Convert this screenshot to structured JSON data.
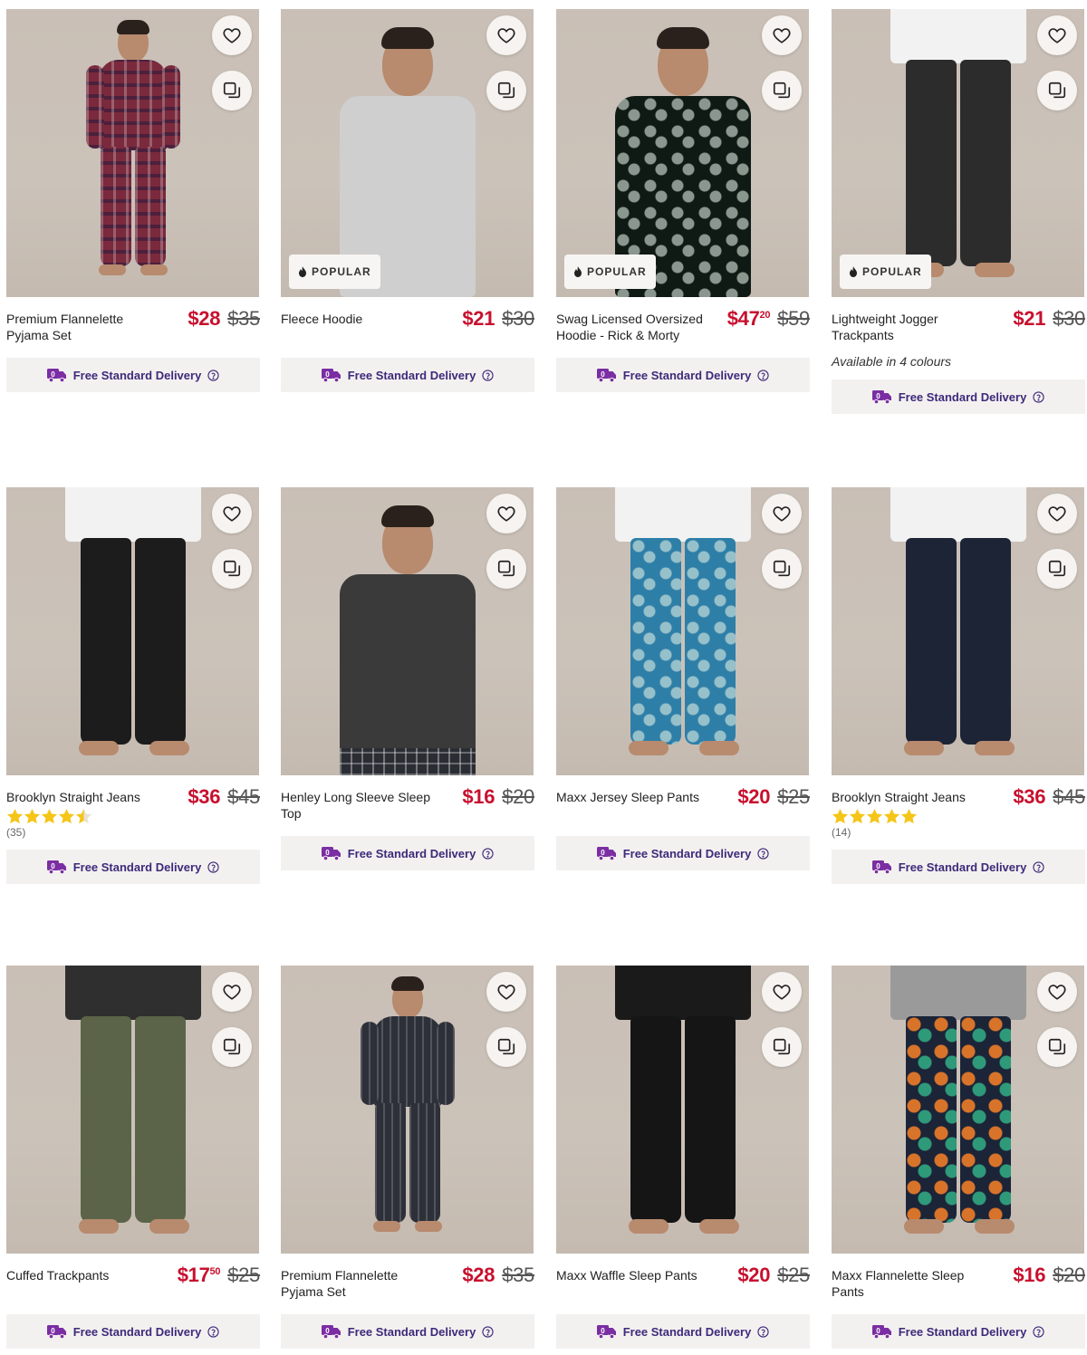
{
  "colors": {
    "sale_price": "#c8102e",
    "delivery_text": "#3d2a7a",
    "delivery_icon": "#7b2ea3",
    "star": "#f5c518",
    "image_bg": "#c9bfb6"
  },
  "delivery_label": "Free Standard Delivery",
  "popular_label": "POPULAR",
  "products": [
    {
      "name": "Premium Flannelette Pyjama Set",
      "price_now": "$28",
      "price_cents": "",
      "price_was": "$35",
      "popular": false,
      "availability": "",
      "rating_count": "",
      "stars": 0
    },
    {
      "name": "Fleece Hoodie",
      "price_now": "$21",
      "price_cents": "",
      "price_was": "$30",
      "popular": true,
      "availability": "",
      "rating_count": "",
      "stars": 0
    },
    {
      "name": "Swag Licensed Oversized Hoodie - Rick & Morty",
      "price_now": "$47",
      "price_cents": "20",
      "price_was": "$59",
      "popular": true,
      "availability": "",
      "rating_count": "",
      "stars": 0
    },
    {
      "name": "Lightweight Jogger Trackpants",
      "price_now": "$21",
      "price_cents": "",
      "price_was": "$30",
      "popular": true,
      "availability": "Available in 4 colours",
      "rating_count": "",
      "stars": 0
    },
    {
      "name": "Brooklyn Straight Jeans",
      "price_now": "$36",
      "price_cents": "",
      "price_was": "$45",
      "popular": false,
      "availability": "",
      "rating_count": "(35)",
      "stars": 4.5
    },
    {
      "name": "Henley Long Sleeve Sleep Top",
      "price_now": "$16",
      "price_cents": "",
      "price_was": "$20",
      "popular": false,
      "availability": "",
      "rating_count": "",
      "stars": 0
    },
    {
      "name": "Maxx Jersey Sleep Pants",
      "price_now": "$20",
      "price_cents": "",
      "price_was": "$25",
      "popular": false,
      "availability": "",
      "rating_count": "",
      "stars": 0
    },
    {
      "name": "Brooklyn Straight Jeans",
      "price_now": "$36",
      "price_cents": "",
      "price_was": "$45",
      "popular": false,
      "availability": "",
      "rating_count": "(14)",
      "stars": 5
    },
    {
      "name": "Cuffed Trackpants",
      "price_now": "$17",
      "price_cents": "50",
      "price_was": "$25",
      "popular": false,
      "availability": "",
      "rating_count": "",
      "stars": 0
    },
    {
      "name": "Premium Flannelette Pyjama Set",
      "price_now": "$28",
      "price_cents": "",
      "price_was": "$35",
      "popular": false,
      "availability": "",
      "rating_count": "",
      "stars": 0
    },
    {
      "name": "Maxx Waffle Sleep Pants",
      "price_now": "$20",
      "price_cents": "",
      "price_was": "$25",
      "popular": false,
      "availability": "",
      "rating_count": "",
      "stars": 0
    },
    {
      "name": "Maxx Flannelette Sleep Pants",
      "price_now": "$16",
      "price_cents": "",
      "price_was": "$20",
      "popular": false,
      "availability": "",
      "rating_count": "",
      "stars": 0
    }
  ],
  "product_images": [
    {
      "top": "#7a2a3c",
      "bottom": "#7a2a3c",
      "pattern": "plaid",
      "crop": "full"
    },
    {
      "top": "#cfcfcf",
      "bottom": "#cfcfcf",
      "pattern": "none",
      "crop": "upper"
    },
    {
      "top": "#101a14",
      "bottom": "#101a14",
      "pattern": "print",
      "crop": "upper"
    },
    {
      "top": "#f2f2f2",
      "bottom": "#2c2c2c",
      "pattern": "none",
      "crop": "legs"
    },
    {
      "top": "#f2f2f2",
      "bottom": "#1c1c1c",
      "pattern": "none",
      "crop": "legs"
    },
    {
      "top": "#3a3a3a",
      "bottom": "#2a2d33",
      "pattern": "plaidpants",
      "crop": "upper"
    },
    {
      "top": "#f2f2f2",
      "bottom": "#2e7fa8",
      "pattern": "print",
      "crop": "legs"
    },
    {
      "top": "#f2f2f2",
      "bottom": "#1c2436",
      "pattern": "none",
      "crop": "legs"
    },
    {
      "top": "#2f2f2f",
      "bottom": "#5b6448",
      "pattern": "none",
      "crop": "legs"
    },
    {
      "top": "#2d3038",
      "bottom": "#2d3038",
      "pattern": "stripe",
      "crop": "full"
    },
    {
      "top": "#1a1a1a",
      "bottom": "#151515",
      "pattern": "none",
      "crop": "legs"
    },
    {
      "top": "#9a9a9a",
      "bottom": "#1c2438",
      "pattern": "dino",
      "crop": "legs"
    }
  ]
}
